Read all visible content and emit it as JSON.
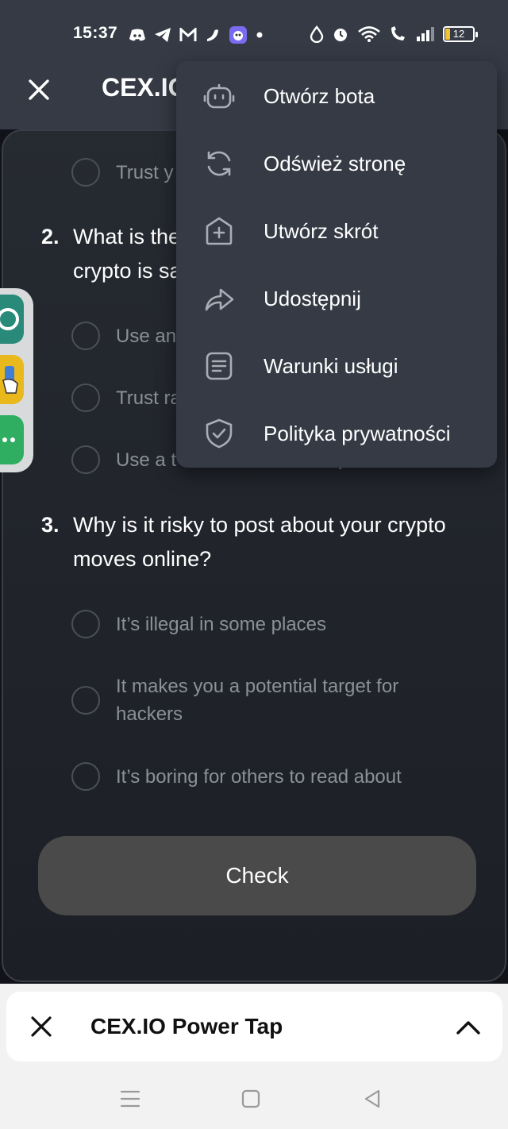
{
  "status_bar": {
    "time": "15:37",
    "battery": "12",
    "left_icons": [
      "discord-icon",
      "telegram-icon",
      "gmail-icon",
      "pepper-icon",
      "app-badge-icon",
      "dot-icon"
    ],
    "right_icons": [
      "drop-icon",
      "alarm-icon",
      "wifi-icon",
      "wifi-calling-icon",
      "signal-icon",
      "battery-icon"
    ]
  },
  "header": {
    "title": "CEX.IO",
    "close_icon": "close-icon"
  },
  "quiz": {
    "q1_partial_option": "Trust y",
    "questions": [
      {
        "number": "2.",
        "text": "What is the\ncrypto is sa",
        "options": [
          "Use an",
          "Trust ra",
          "Use a t"
        ]
      },
      {
        "number": "3.",
        "text": "Why is it risky to post about your crypto moves online?",
        "options": [
          "It’s illegal in some places",
          "It makes you a potential target for hackers",
          "It’s boring for others to read about"
        ]
      }
    ],
    "q2_option3_tail": "p",
    "check_label": "Check"
  },
  "menu": {
    "items": [
      {
        "label": "Otwórz bota",
        "icon": "bot-icon"
      },
      {
        "label": "Odśwież stronę",
        "icon": "refresh-icon"
      },
      {
        "label": "Utwórz skrót",
        "icon": "add-shortcut-icon"
      },
      {
        "label": "Udostępnij",
        "icon": "share-icon"
      },
      {
        "label": "Warunki usługi",
        "icon": "document-icon"
      },
      {
        "label": "Polityka prywatności",
        "icon": "shield-check-icon"
      }
    ]
  },
  "mini_app_bar": {
    "title": "CEX.IO Power Tap",
    "close_icon": "close-icon",
    "expand_icon": "chevron-up-icon"
  },
  "nav_bar": {
    "buttons": [
      "menu-icon",
      "home-square-icon",
      "back-triangle-icon"
    ]
  },
  "colors": {
    "header_bg": "#353a45",
    "menu_bg": "#353a45",
    "sheet_bg": "#22262c",
    "check_button_bg": "#4a4a4a",
    "side_app_teal": "#2a8a7a",
    "side_app_yellow": "#e8b81c",
    "side_app_green": "#2fae62"
  }
}
